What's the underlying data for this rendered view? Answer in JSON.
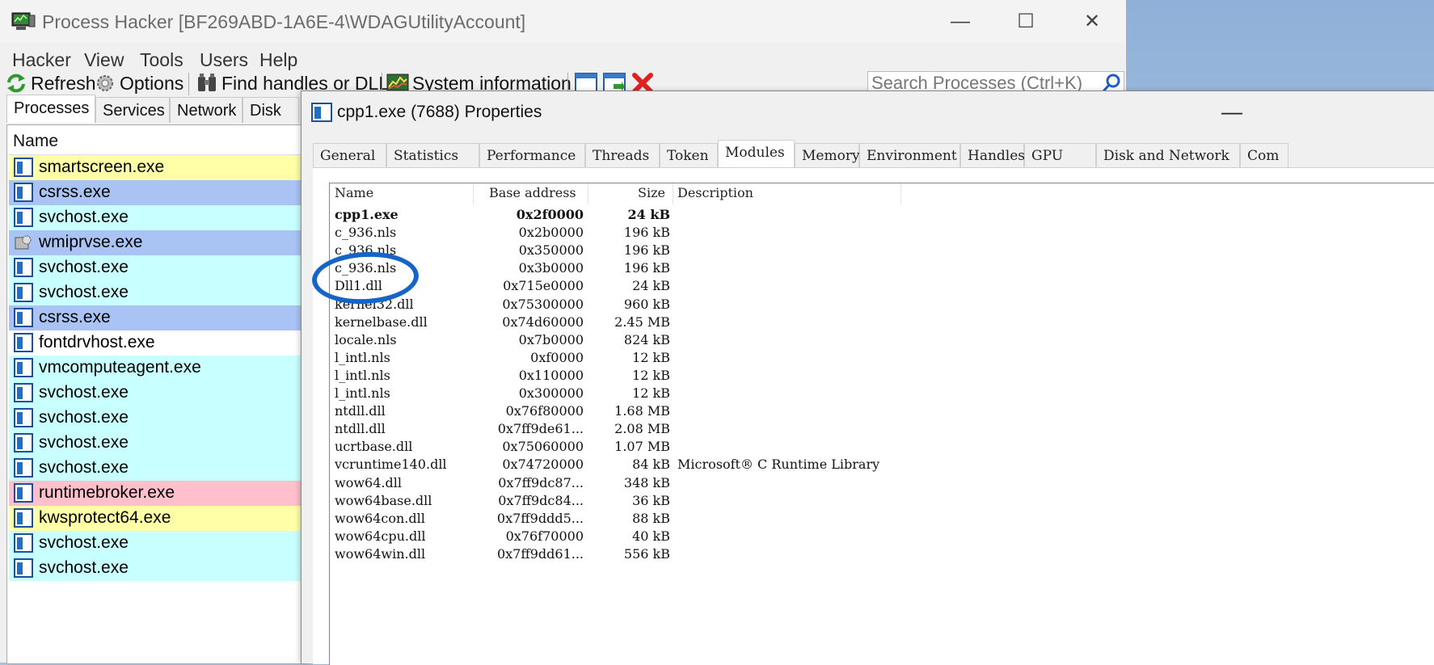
{
  "main_window": {
    "title": "Process Hacker [BF269ABD-1A6E-4\\WDAGUtilityAccount]",
    "controls": {
      "minimize": "—",
      "maximize": "☐",
      "close": "✕"
    }
  },
  "menu": [
    "Hacker",
    "View",
    "Tools",
    "Users",
    "Help"
  ],
  "toolbar": {
    "refresh": "Refresh",
    "options": "Options",
    "find_handles": "Find handles or DLLs",
    "system_info": "System information",
    "search_placeholder": "Search Processes (Ctrl+K)"
  },
  "main_tabs": [
    "Processes",
    "Services",
    "Network",
    "Disk"
  ],
  "process_list": {
    "column": "Name",
    "rows": [
      {
        "name": "smartscreen.exe",
        "color": "#ffffa8"
      },
      {
        "name": "csrss.exe",
        "color": "#aac3f5"
      },
      {
        "name": "svchost.exe",
        "color": "#c8ffff"
      },
      {
        "name": "wmiprvse.exe",
        "color": "#aac3f5"
      },
      {
        "name": "svchost.exe",
        "color": "#c8ffff"
      },
      {
        "name": "svchost.exe",
        "color": "#c8ffff"
      },
      {
        "name": "csrss.exe",
        "color": "#aac3f5"
      },
      {
        "name": "fontdrvhost.exe",
        "color": "#ffffff"
      },
      {
        "name": "vmcomputeagent.exe",
        "color": "#c8ffff"
      },
      {
        "name": "svchost.exe",
        "color": "#c8ffff"
      },
      {
        "name": "svchost.exe",
        "color": "#c8ffff"
      },
      {
        "name": "svchost.exe",
        "color": "#c8ffff"
      },
      {
        "name": "svchost.exe",
        "color": "#c8ffff"
      },
      {
        "name": "runtimebroker.exe",
        "color": "#ffc0cb"
      },
      {
        "name": "kwsprotect64.exe",
        "color": "#ffffa8"
      },
      {
        "name": "svchost.exe",
        "color": "#c8ffff"
      },
      {
        "name": "svchost.exe",
        "color": "#c8ffff"
      }
    ]
  },
  "dialog": {
    "title": "cpp1.exe (7688) Properties",
    "minimize": "—",
    "tabs": [
      "General",
      "Statistics",
      "Performance",
      "Threads",
      "Token",
      "Modules",
      "Memory",
      "Environment",
      "Handles",
      "GPU",
      "Disk and Network",
      "Com"
    ],
    "active_tab": "Modules",
    "columns": {
      "name": "Name",
      "base": "Base address",
      "size": "Size",
      "desc": "Description"
    },
    "modules": [
      {
        "name": "cpp1.exe",
        "base": "0x2f0000",
        "size": "24 kB",
        "desc": "",
        "bold": true
      },
      {
        "name": "c_936.nls",
        "base": "0x2b0000",
        "size": "196 kB",
        "desc": ""
      },
      {
        "name": "c_936.nls",
        "base": "0x350000",
        "size": "196 kB",
        "desc": ""
      },
      {
        "name": "c_936.nls",
        "base": "0x3b0000",
        "size": "196 kB",
        "desc": ""
      },
      {
        "name": "Dll1.dll",
        "base": "0x715e0000",
        "size": "24 kB",
        "desc": ""
      },
      {
        "name": "kernel32.dll",
        "base": "0x75300000",
        "size": "960 kB",
        "desc": ""
      },
      {
        "name": "kernelbase.dll",
        "base": "0x74d60000",
        "size": "2.45 MB",
        "desc": ""
      },
      {
        "name": "locale.nls",
        "base": "0x7b0000",
        "size": "824 kB",
        "desc": ""
      },
      {
        "name": "l_intl.nls",
        "base": "0xf0000",
        "size": "12 kB",
        "desc": ""
      },
      {
        "name": "l_intl.nls",
        "base": "0x110000",
        "size": "12 kB",
        "desc": ""
      },
      {
        "name": "l_intl.nls",
        "base": "0x300000",
        "size": "12 kB",
        "desc": ""
      },
      {
        "name": "ntdll.dll",
        "base": "0x76f80000",
        "size": "1.68 MB",
        "desc": ""
      },
      {
        "name": "ntdll.dll",
        "base": "0x7ff9de61...",
        "size": "2.08 MB",
        "desc": ""
      },
      {
        "name": "ucrtbase.dll",
        "base": "0x75060000",
        "size": "1.07 MB",
        "desc": ""
      },
      {
        "name": "vcruntime140.dll",
        "base": "0x74720000",
        "size": "84 kB",
        "desc": "Microsoft® C Runtime Library"
      },
      {
        "name": "wow64.dll",
        "base": "0x7ff9dc87...",
        "size": "348 kB",
        "desc": ""
      },
      {
        "name": "wow64base.dll",
        "base": "0x7ff9dc84...",
        "size": "36 kB",
        "desc": ""
      },
      {
        "name": "wow64con.dll",
        "base": "0x7ff9ddd5...",
        "size": "88 kB",
        "desc": ""
      },
      {
        "name": "wow64cpu.dll",
        "base": "0x76f70000",
        "size": "40 kB",
        "desc": ""
      },
      {
        "name": "wow64win.dll",
        "base": "0x7ff9dd61...",
        "size": "556 kB",
        "desc": ""
      }
    ]
  }
}
